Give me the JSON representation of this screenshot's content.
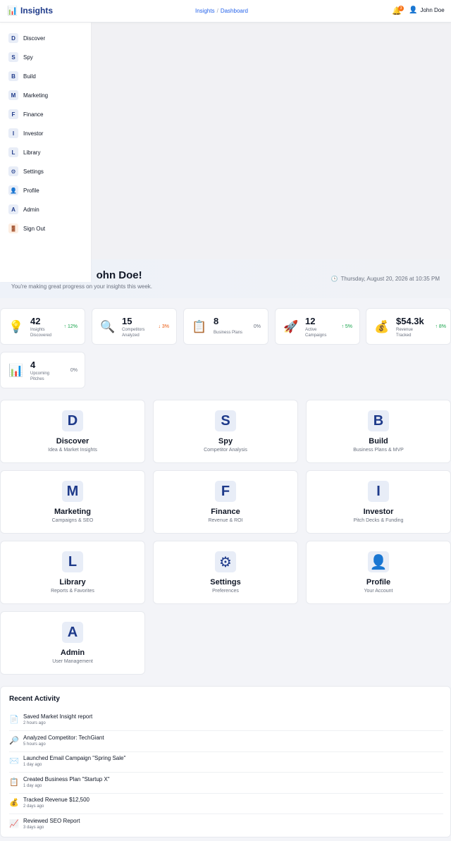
{
  "header": {
    "brand_icon": "📊",
    "brand_name": "Insights",
    "breadcrumb": [
      "Insights",
      "/",
      "Dashboard"
    ],
    "notification_count": "3",
    "bell_icon": "🔔",
    "user_icon": "👤",
    "user_name": "John Doe"
  },
  "sidebar": {
    "items": [
      {
        "badge": "D",
        "label": "Discover"
      },
      {
        "badge": "S",
        "label": "Spy"
      },
      {
        "badge": "B",
        "label": "Build"
      },
      {
        "badge": "M",
        "label": "Marketing"
      },
      {
        "badge": "F",
        "label": "Finance"
      },
      {
        "badge": "I",
        "label": "Investor"
      },
      {
        "badge": "L",
        "label": "Library"
      },
      {
        "badge": "⚙",
        "label": "Settings"
      },
      {
        "badge": "👤",
        "label": "Profile"
      },
      {
        "badge": "A",
        "label": "Admin"
      },
      {
        "badge": "🚪",
        "label": "Sign Out"
      }
    ]
  },
  "welcome": {
    "title_visible": "ohn Doe!",
    "subtitle": "You're making great progress on your insights this week.",
    "clock_icon": "🕒",
    "datetime": "Thursday, August 20, 2026 at 10:35 PM"
  },
  "stats": [
    {
      "icon": "💡",
      "value": "42",
      "label": "Insights Discovered",
      "change": "↑ 12%",
      "trend": "up"
    },
    {
      "icon": "🔍",
      "value": "15",
      "label": "Competitors Analyzed",
      "change": "↓ 3%",
      "trend": "down"
    },
    {
      "icon": "📋",
      "value": "8",
      "label": "Business Plans",
      "change": "0%",
      "trend": "flat"
    },
    {
      "icon": "🚀",
      "value": "12",
      "label": "Active Campaigns",
      "change": "↑ 5%",
      "trend": "up"
    },
    {
      "icon": "💰",
      "value": "$54.3k",
      "label": "Revenue Tracked",
      "change": "↑ 8%",
      "trend": "up"
    },
    {
      "icon": "📊",
      "value": "4",
      "label": "Upcoming Pitches",
      "change": "0%",
      "trend": "flat"
    }
  ],
  "features": [
    {
      "badge": "D",
      "title": "Discover",
      "subtitle": "Idea & Market Insights"
    },
    {
      "badge": "S",
      "title": "Spy",
      "subtitle": "Competitor Analysis"
    },
    {
      "badge": "B",
      "title": "Build",
      "subtitle": "Business Plans & MVP"
    },
    {
      "badge": "M",
      "title": "Marketing",
      "subtitle": "Campaigns & SEO"
    },
    {
      "badge": "F",
      "title": "Finance",
      "subtitle": "Revenue & ROI"
    },
    {
      "badge": "I",
      "title": "Investor",
      "subtitle": "Pitch Decks & Funding"
    },
    {
      "badge": "L",
      "title": "Library",
      "subtitle": "Reports & Favorites"
    },
    {
      "badge": "⚙",
      "title": "Settings",
      "subtitle": "Preferences"
    },
    {
      "badge": "👤",
      "title": "Profile",
      "subtitle": "Your Account"
    },
    {
      "badge": "A",
      "title": "Admin",
      "subtitle": "User Management"
    }
  ],
  "recent": {
    "title": "Recent Activity",
    "items": [
      {
        "icon": "📄",
        "text": "Saved Market Insight report",
        "time": "2 hours ago"
      },
      {
        "icon": "🔎",
        "text": "Analyzed Competitor: TechGiant",
        "time": "5 hours ago"
      },
      {
        "icon": "✉️",
        "text": "Launched Email Campaign \"Spring Sale\"",
        "time": "1 day ago"
      },
      {
        "icon": "📋",
        "text": "Created Business Plan \"Startup X\"",
        "time": "1 day ago"
      },
      {
        "icon": "💰",
        "text": "Tracked Revenue $12,500",
        "time": "2 days ago"
      },
      {
        "icon": "📈",
        "text": "Reviewed SEO Report",
        "time": "3 days ago"
      }
    ]
  }
}
